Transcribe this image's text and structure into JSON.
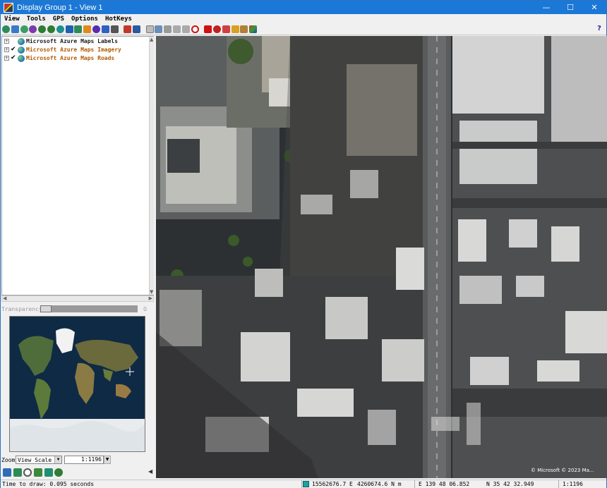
{
  "window": {
    "title": "Display Group 1 - View 1",
    "controls": {
      "minimize": "—",
      "maximize": "☐",
      "close": "✕"
    }
  },
  "menu": [
    "View",
    "Tools",
    "GPS",
    "Options",
    "HotKeys"
  ],
  "layers": [
    {
      "label": "Microsoft Azure Maps Labels",
      "checked": false,
      "color": "#1a1a1a"
    },
    {
      "label": "Microsoft Azure Maps Imagery",
      "checked": true,
      "color": "#b35a00"
    },
    {
      "label": "Microsoft Azure Maps Roads",
      "checked": true,
      "color": "#b35a00"
    }
  ],
  "transparency": {
    "label": "Transparency",
    "value": "0",
    "level": 0
  },
  "zoom": {
    "label": "Zoom",
    "mode": "View Scale",
    "scale": "1:1196"
  },
  "map": {
    "attribution": "© Microsoft © 2023 Ma..."
  },
  "status": {
    "message": "Time to draw: 0.095 seconds",
    "easting": "15562676.7 E",
    "northing": "4260674.6 N m",
    "longitude": "E 139 48 06.852",
    "latitude": "N 35 42 32.949",
    "scale": "1:1196"
  },
  "icons": {
    "toolbar": [
      "zoom-to-full-icon",
      "zoom-to-layer-icon",
      "pan-icon",
      "recenter-icon",
      "zoom-in-icon",
      "zoom-out-icon",
      "zoom-box-icon",
      "grid-icon",
      "refresh-icon",
      "layer-icon",
      "globe-icon",
      "stop-icon",
      "print-icon",
      "add-layer-icon",
      "remove-layer-icon",
      "select-icon",
      "measure-icon",
      "info-icon",
      "prev-view-icon",
      "next-view-icon",
      "cancel-icon",
      "crosshair-icon",
      "magnify-icon",
      "pointer-icon",
      "sketch-icon",
      "style-icon",
      "palette-icon"
    ],
    "bottom": [
      "list-icon",
      "view-icon",
      "find-icon",
      "add-icon",
      "refresh-icon",
      "zoom-icon"
    ]
  },
  "colors": {
    "titlebar": "#1b78d6",
    "layer_orange": "#b35a00",
    "map_bg": "#2a2d30"
  }
}
